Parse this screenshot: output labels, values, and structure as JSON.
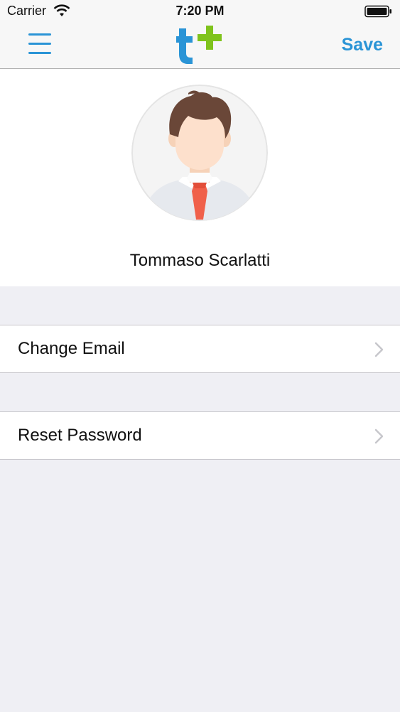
{
  "status_bar": {
    "carrier": "Carrier",
    "time": "7:20 PM",
    "wifi_icon": "wifi-icon",
    "battery_icon": "battery-icon"
  },
  "nav_bar": {
    "menu_icon": "hamburger-menu-icon",
    "logo": "t-plus-logo",
    "save_label": "Save"
  },
  "profile": {
    "avatar_icon": "user-avatar-icon",
    "name": "Tommaso Scarlatti"
  },
  "settings": {
    "items": [
      {
        "label": "Change Email",
        "icon": "chevron-right-icon"
      },
      {
        "label": "Reset Password",
        "icon": "chevron-right-icon"
      }
    ]
  },
  "colors": {
    "accent": "#2a94d6",
    "logo_green": "#7fc31c",
    "background": "#efeff4",
    "tie": "#f0604a"
  }
}
